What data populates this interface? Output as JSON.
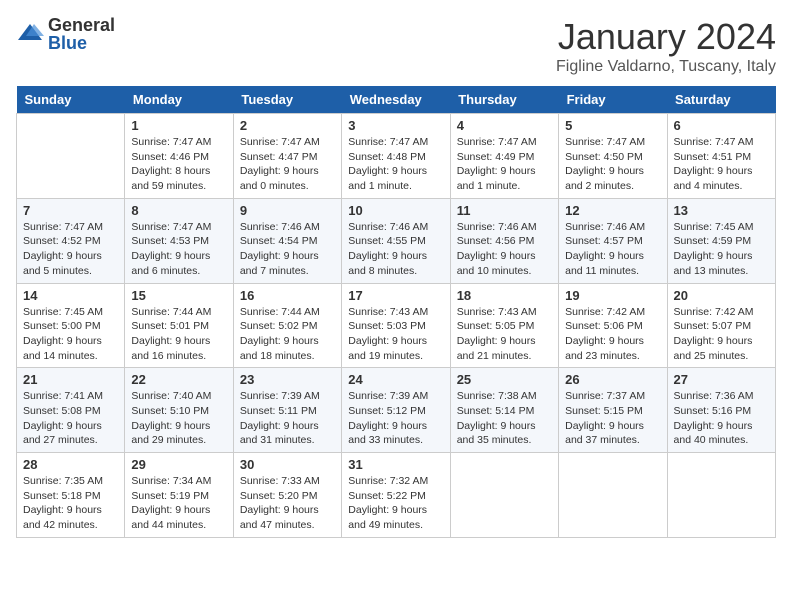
{
  "logo": {
    "general": "General",
    "blue": "Blue"
  },
  "title": "January 2024",
  "location": "Figline Valdarno, Tuscany, Italy",
  "days_of_week": [
    "Sunday",
    "Monday",
    "Tuesday",
    "Wednesday",
    "Thursday",
    "Friday",
    "Saturday"
  ],
  "weeks": [
    [
      {
        "day": "",
        "sunrise": "",
        "sunset": "",
        "daylight": ""
      },
      {
        "day": "1",
        "sunrise": "Sunrise: 7:47 AM",
        "sunset": "Sunset: 4:46 PM",
        "daylight": "Daylight: 8 hours and 59 minutes."
      },
      {
        "day": "2",
        "sunrise": "Sunrise: 7:47 AM",
        "sunset": "Sunset: 4:47 PM",
        "daylight": "Daylight: 9 hours and 0 minutes."
      },
      {
        "day": "3",
        "sunrise": "Sunrise: 7:47 AM",
        "sunset": "Sunset: 4:48 PM",
        "daylight": "Daylight: 9 hours and 1 minute."
      },
      {
        "day": "4",
        "sunrise": "Sunrise: 7:47 AM",
        "sunset": "Sunset: 4:49 PM",
        "daylight": "Daylight: 9 hours and 1 minute."
      },
      {
        "day": "5",
        "sunrise": "Sunrise: 7:47 AM",
        "sunset": "Sunset: 4:50 PM",
        "daylight": "Daylight: 9 hours and 2 minutes."
      },
      {
        "day": "6",
        "sunrise": "Sunrise: 7:47 AM",
        "sunset": "Sunset: 4:51 PM",
        "daylight": "Daylight: 9 hours and 4 minutes."
      }
    ],
    [
      {
        "day": "7",
        "sunrise": "Sunrise: 7:47 AM",
        "sunset": "Sunset: 4:52 PM",
        "daylight": "Daylight: 9 hours and 5 minutes."
      },
      {
        "day": "8",
        "sunrise": "Sunrise: 7:47 AM",
        "sunset": "Sunset: 4:53 PM",
        "daylight": "Daylight: 9 hours and 6 minutes."
      },
      {
        "day": "9",
        "sunrise": "Sunrise: 7:46 AM",
        "sunset": "Sunset: 4:54 PM",
        "daylight": "Daylight: 9 hours and 7 minutes."
      },
      {
        "day": "10",
        "sunrise": "Sunrise: 7:46 AM",
        "sunset": "Sunset: 4:55 PM",
        "daylight": "Daylight: 9 hours and 8 minutes."
      },
      {
        "day": "11",
        "sunrise": "Sunrise: 7:46 AM",
        "sunset": "Sunset: 4:56 PM",
        "daylight": "Daylight: 9 hours and 10 minutes."
      },
      {
        "day": "12",
        "sunrise": "Sunrise: 7:46 AM",
        "sunset": "Sunset: 4:57 PM",
        "daylight": "Daylight: 9 hours and 11 minutes."
      },
      {
        "day": "13",
        "sunrise": "Sunrise: 7:45 AM",
        "sunset": "Sunset: 4:59 PM",
        "daylight": "Daylight: 9 hours and 13 minutes."
      }
    ],
    [
      {
        "day": "14",
        "sunrise": "Sunrise: 7:45 AM",
        "sunset": "Sunset: 5:00 PM",
        "daylight": "Daylight: 9 hours and 14 minutes."
      },
      {
        "day": "15",
        "sunrise": "Sunrise: 7:44 AM",
        "sunset": "Sunset: 5:01 PM",
        "daylight": "Daylight: 9 hours and 16 minutes."
      },
      {
        "day": "16",
        "sunrise": "Sunrise: 7:44 AM",
        "sunset": "Sunset: 5:02 PM",
        "daylight": "Daylight: 9 hours and 18 minutes."
      },
      {
        "day": "17",
        "sunrise": "Sunrise: 7:43 AM",
        "sunset": "Sunset: 5:03 PM",
        "daylight": "Daylight: 9 hours and 19 minutes."
      },
      {
        "day": "18",
        "sunrise": "Sunrise: 7:43 AM",
        "sunset": "Sunset: 5:05 PM",
        "daylight": "Daylight: 9 hours and 21 minutes."
      },
      {
        "day": "19",
        "sunrise": "Sunrise: 7:42 AM",
        "sunset": "Sunset: 5:06 PM",
        "daylight": "Daylight: 9 hours and 23 minutes."
      },
      {
        "day": "20",
        "sunrise": "Sunrise: 7:42 AM",
        "sunset": "Sunset: 5:07 PM",
        "daylight": "Daylight: 9 hours and 25 minutes."
      }
    ],
    [
      {
        "day": "21",
        "sunrise": "Sunrise: 7:41 AM",
        "sunset": "Sunset: 5:08 PM",
        "daylight": "Daylight: 9 hours and 27 minutes."
      },
      {
        "day": "22",
        "sunrise": "Sunrise: 7:40 AM",
        "sunset": "Sunset: 5:10 PM",
        "daylight": "Daylight: 9 hours and 29 minutes."
      },
      {
        "day": "23",
        "sunrise": "Sunrise: 7:39 AM",
        "sunset": "Sunset: 5:11 PM",
        "daylight": "Daylight: 9 hours and 31 minutes."
      },
      {
        "day": "24",
        "sunrise": "Sunrise: 7:39 AM",
        "sunset": "Sunset: 5:12 PM",
        "daylight": "Daylight: 9 hours and 33 minutes."
      },
      {
        "day": "25",
        "sunrise": "Sunrise: 7:38 AM",
        "sunset": "Sunset: 5:14 PM",
        "daylight": "Daylight: 9 hours and 35 minutes."
      },
      {
        "day": "26",
        "sunrise": "Sunrise: 7:37 AM",
        "sunset": "Sunset: 5:15 PM",
        "daylight": "Daylight: 9 hours and 37 minutes."
      },
      {
        "day": "27",
        "sunrise": "Sunrise: 7:36 AM",
        "sunset": "Sunset: 5:16 PM",
        "daylight": "Daylight: 9 hours and 40 minutes."
      }
    ],
    [
      {
        "day": "28",
        "sunrise": "Sunrise: 7:35 AM",
        "sunset": "Sunset: 5:18 PM",
        "daylight": "Daylight: 9 hours and 42 minutes."
      },
      {
        "day": "29",
        "sunrise": "Sunrise: 7:34 AM",
        "sunset": "Sunset: 5:19 PM",
        "daylight": "Daylight: 9 hours and 44 minutes."
      },
      {
        "day": "30",
        "sunrise": "Sunrise: 7:33 AM",
        "sunset": "Sunset: 5:20 PM",
        "daylight": "Daylight: 9 hours and 47 minutes."
      },
      {
        "day": "31",
        "sunrise": "Sunrise: 7:32 AM",
        "sunset": "Sunset: 5:22 PM",
        "daylight": "Daylight: 9 hours and 49 minutes."
      },
      {
        "day": "",
        "sunrise": "",
        "sunset": "",
        "daylight": ""
      },
      {
        "day": "",
        "sunrise": "",
        "sunset": "",
        "daylight": ""
      },
      {
        "day": "",
        "sunrise": "",
        "sunset": "",
        "daylight": ""
      }
    ]
  ]
}
